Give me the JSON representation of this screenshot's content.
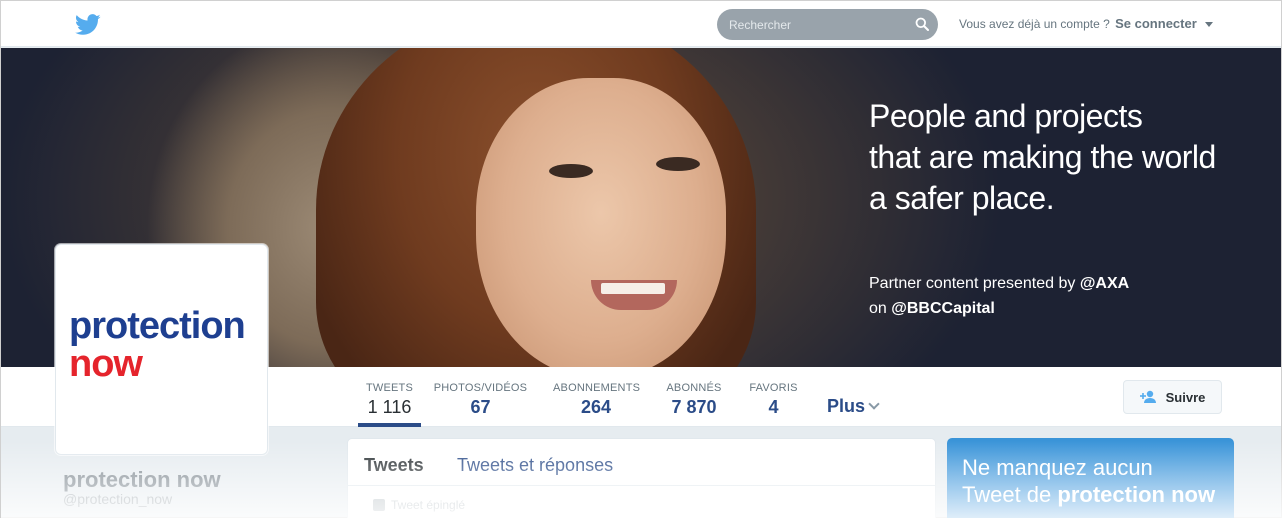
{
  "topbar": {
    "search_placeholder": "Rechercher",
    "login_prompt": "Vous avez déjà un compte ?",
    "login_link": "Se connecter"
  },
  "banner": {
    "headline_lines": [
      "People and projects",
      "that are making the world",
      "a safer place."
    ],
    "partner_line1_text": "Partner content presented by",
    "partner_line1_handle": "@AXA",
    "partner_line2_text": "on",
    "partner_line2_handle": "@BBCCapital"
  },
  "avatar": {
    "logo_line1": "protection",
    "logo_line2": "now"
  },
  "profile": {
    "name": "protection now",
    "handle": "@protection_now"
  },
  "stats": [
    {
      "label": "TWEETS",
      "value": "1 116"
    },
    {
      "label": "PHOTOS/VIDÉOS",
      "value": "67"
    },
    {
      "label": "ABONNEMENTS",
      "value": "264"
    },
    {
      "label": "ABONNÉS",
      "value": "7 870"
    },
    {
      "label": "FAVORIS",
      "value": "4"
    }
  ],
  "more_label": "Plus",
  "follow_label": "Suivre",
  "timeline": {
    "tabs": [
      "Tweets",
      "Tweets et réponses"
    ],
    "pinned_label": "Tweet épinglé"
  },
  "promo": {
    "line1": "Ne manquez aucun",
    "line2_prefix": "Tweet de",
    "line2_name": "protection now"
  },
  "colors": {
    "brand_blue": "#2b4c88",
    "twitter_blue": "#55acee",
    "logo_red": "#e5242c",
    "logo_navy": "#1e3f90"
  }
}
